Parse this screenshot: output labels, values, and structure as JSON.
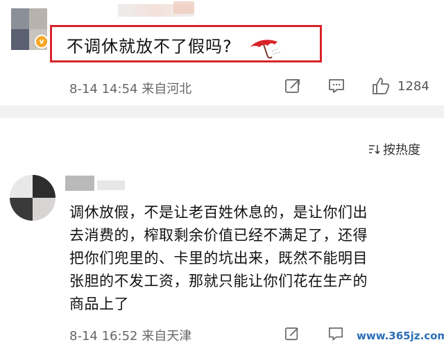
{
  "post1": {
    "question": "不调休就放不了假吗?",
    "date": "8-14",
    "time": "14:54",
    "location": "来自河北",
    "like_count": "1284",
    "badge": "v"
  },
  "sort": {
    "label": "按热度"
  },
  "comment": {
    "lines": [
      "调休放假，不是让老百姓休息的，是让你们出",
      "去消费的，榨取剩余价值已经不满足了，还得",
      "把你们兜里的、卡里的坑出来，既然不能明目",
      "张胆的不发工资，那就只能让你们花在生产的",
      "商品上了"
    ],
    "date": "8-14",
    "time": "16:52",
    "location": "来自天津"
  },
  "watermark": "www.365jz.com",
  "colors": {
    "highlight": "#d8232a",
    "badge": "#f5a623",
    "divider": "#f1f1f3",
    "meta": "#666666"
  },
  "icons": [
    "share-icon",
    "comment-icon",
    "like-icon",
    "sort-icon",
    "umbrella-icon"
  ]
}
